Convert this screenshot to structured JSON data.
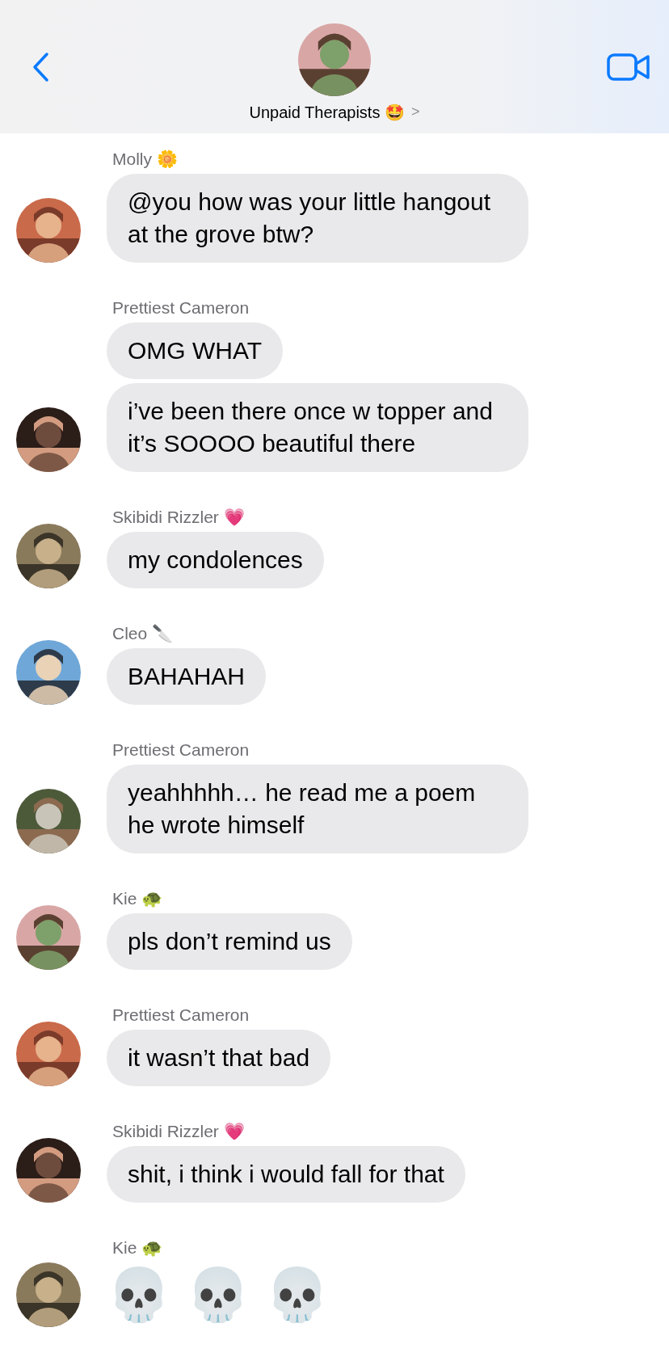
{
  "header": {
    "title": "Unpaid Therapists 🤩",
    "chevron": ">"
  },
  "groups": [
    {
      "sender": "Molly 🌼",
      "messages": [
        {
          "kind": "bubble",
          "text": "@you how was your little hangout at the grove btw?"
        }
      ]
    },
    {
      "sender": "Prettiest Cameron",
      "messages": [
        {
          "kind": "bubble",
          "text": "OMG WHAT"
        },
        {
          "kind": "bubble",
          "text": "i’ve been there once w topper and it’s SOOOO beautiful there"
        }
      ]
    },
    {
      "sender": "Skibidi Rizzler 💗",
      "messages": [
        {
          "kind": "bubble",
          "text": "my condolences"
        }
      ]
    },
    {
      "sender": "Cleo 🔪",
      "messages": [
        {
          "kind": "bubble",
          "text": "BAHAHAH"
        }
      ]
    },
    {
      "sender": "Prettiest Cameron",
      "messages": [
        {
          "kind": "bubble",
          "text": "yeahhhhh… he read me a poem he wrote himself"
        }
      ]
    },
    {
      "sender": "Kie 🐢",
      "messages": [
        {
          "kind": "bubble",
          "text": "pls don’t remind us"
        }
      ]
    },
    {
      "sender": "Prettiest Cameron",
      "messages": [
        {
          "kind": "bubble",
          "text": "it wasn’t that bad"
        }
      ]
    },
    {
      "sender": "Skibidi Rizzler 💗",
      "messages": [
        {
          "kind": "bubble",
          "text": "shit, i think i would fall for that"
        }
      ]
    },
    {
      "sender": "Kie 🐢",
      "messages": [
        {
          "kind": "emoji",
          "text": "💀 💀 💀"
        }
      ]
    }
  ]
}
